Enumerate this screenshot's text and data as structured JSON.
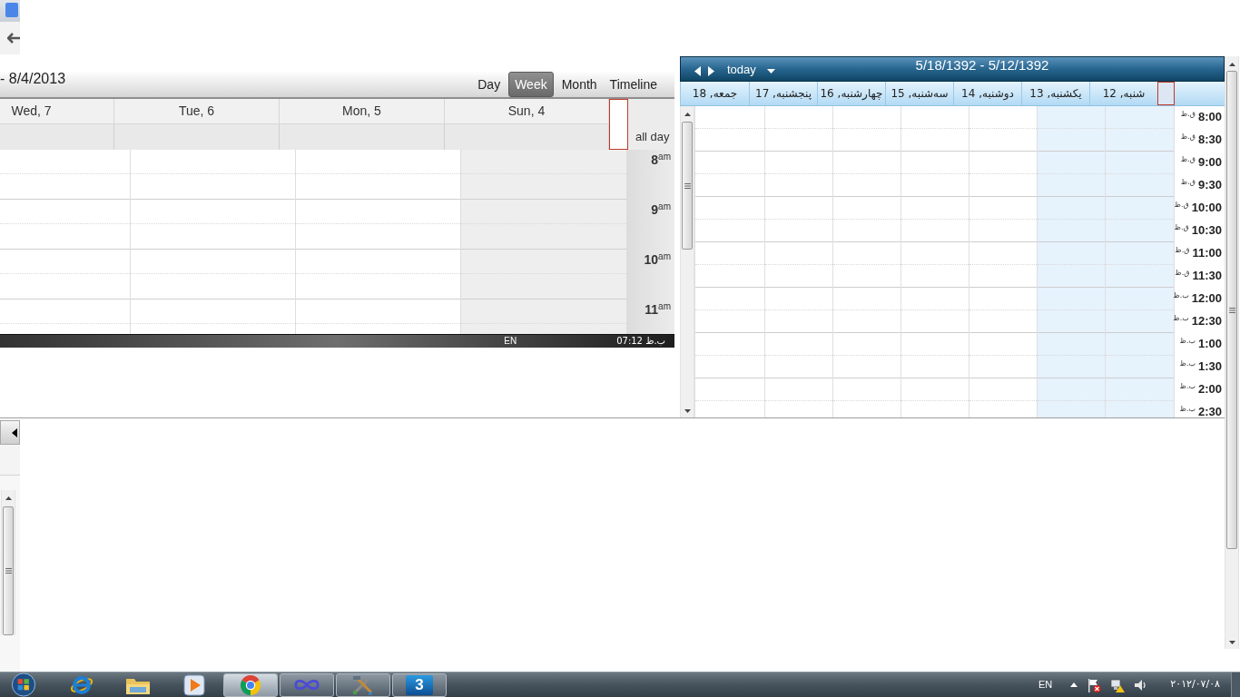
{
  "left_calendar": {
    "date_range": "- 8/4/2013",
    "views": [
      {
        "label": "Timeline",
        "selected": false
      },
      {
        "label": "Month",
        "selected": false
      },
      {
        "label": "Week",
        "selected": true
      },
      {
        "label": "Day",
        "selected": false
      }
    ],
    "days": [
      {
        "label": "Sun, 4",
        "highlighted": true
      },
      {
        "label": "Mon, 5",
        "highlighted": false
      },
      {
        "label": "Tue, 6",
        "highlighted": false
      },
      {
        "label": "Wed, 7",
        "highlighted": false
      }
    ],
    "all_day_label": "all day",
    "hours": [
      "8$^{am}$",
      "9$^{am}$",
      "10$^{am}$",
      "11$^{am}$"
    ]
  },
  "clock_strip": {
    "language": "EN",
    "time": "07:12 ب.ظ"
  },
  "right_calendar": {
    "today_button": "today",
    "title": "5/18/1392 - 5/12/1392",
    "days": [
      {
        "label": "شنبه, 12",
        "highlighted": true
      },
      {
        "label": "یکشنبه, 13",
        "highlighted": true
      },
      {
        "label": "دوشنبه, 14",
        "highlighted": false
      },
      {
        "label": "سه‌شنبه, 15",
        "highlighted": false
      },
      {
        "label": "چهارشنبه, 16",
        "highlighted": false
      },
      {
        "label": "پنجشنبه, 17",
        "highlighted": false
      },
      {
        "label": "جمعه, 18",
        "highlighted": false
      }
    ],
    "times": [
      {
        "time": "8:00",
        "period": "ق.ظ"
      },
      {
        "time": "8:30",
        "period": "ق.ظ"
      },
      {
        "time": "9:00",
        "period": "ق.ظ"
      },
      {
        "time": "9:30",
        "period": "ق.ظ"
      },
      {
        "time": "10:00",
        "period": "ق.ظ"
      },
      {
        "time": "10:30",
        "period": "ق.ظ"
      },
      {
        "time": "11:00",
        "period": "ق.ظ"
      },
      {
        "time": "11:30",
        "period": "ق.ظ"
      },
      {
        "time": "12:00",
        "period": "ب.ظ"
      },
      {
        "time": "12:30",
        "period": "ب.ظ"
      },
      {
        "time": "1:00",
        "period": "ب.ظ"
      },
      {
        "time": "1:30",
        "period": "ب.ظ"
      },
      {
        "time": "2:00",
        "period": "ب.ظ"
      },
      {
        "time": "2:30",
        "period": "ب.ظ"
      }
    ]
  },
  "taskbar": {
    "apps": [
      {
        "kind": "browser-e",
        "running": false,
        "selected": false
      },
      {
        "kind": "folder",
        "running": false,
        "selected": false
      },
      {
        "kind": "media",
        "running": false,
        "selected": false
      },
      {
        "kind": "round-logo",
        "running": true,
        "selected": true
      },
      {
        "kind": "infinity",
        "running": true,
        "selected": false
      },
      {
        "kind": "tools",
        "running": true,
        "selected": false
      },
      {
        "kind": "badge",
        "glyph": "3",
        "running": true,
        "selected": false
      }
    ],
    "language": "EN",
    "date": "۲۰۱۲/۰۷/۰۸"
  }
}
